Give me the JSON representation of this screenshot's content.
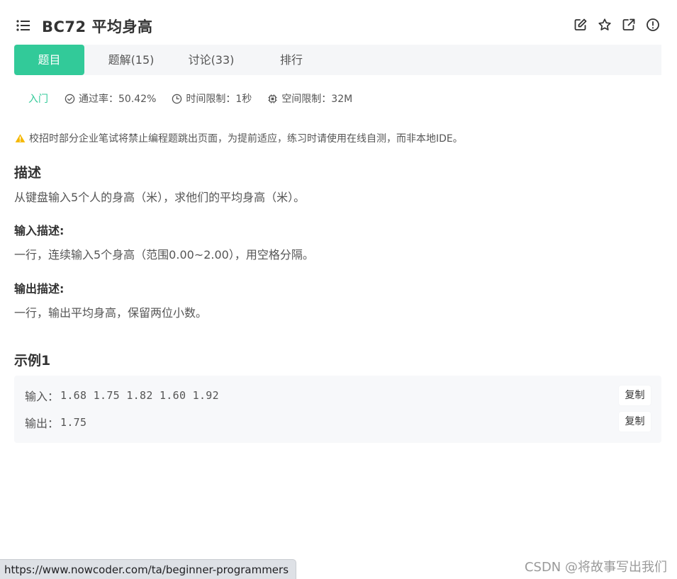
{
  "header": {
    "title": "BC72  平均身高"
  },
  "tabs": [
    {
      "label": "题目",
      "active": true
    },
    {
      "label": "题解(15)",
      "active": false
    },
    {
      "label": "讨论(33)",
      "active": false
    },
    {
      "label": "排行",
      "active": false
    }
  ],
  "meta": {
    "level": "入门",
    "pass_rate": "通过率：50.42%",
    "time_limit": "时间限制：1秒",
    "space_limit": "空间限制：32M"
  },
  "notice": "校招时部分企业笔试将禁止编程题跳出页面，为提前适应，练习时请使用在线自测，而非本地IDE。",
  "description": {
    "heading": "描述",
    "text": "从键盘输入5个人的身高（米），求他们的平均身高（米）。"
  },
  "input_desc": {
    "heading": "输入描述:",
    "text": "一行，连续输入5个身高（范围0.00~2.00），用空格分隔。"
  },
  "output_desc": {
    "heading": "输出描述:",
    "text": "一行，输出平均身高，保留两位小数。"
  },
  "example": {
    "heading": "示例1",
    "input_label": "输入：",
    "input_value": "1.68 1.75 1.82 1.60 1.92",
    "output_label": "输出：",
    "output_value": "1.75",
    "copy_label": "复制"
  },
  "status_url": "https://www.nowcoder.com/ta/beginner-programmers",
  "watermark": "CSDN @将故事写出我们",
  "colors": {
    "accent": "#32ca99",
    "warning": "#f5b700"
  }
}
